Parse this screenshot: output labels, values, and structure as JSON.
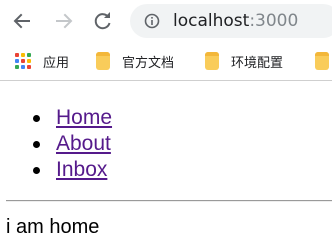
{
  "browser": {
    "url_host": "localhost",
    "url_port": ":3000",
    "icons": {
      "back": "arrow-left-icon",
      "forward": "arrow-right-icon",
      "reload": "reload-icon",
      "site_info": "info-icon"
    }
  },
  "bookmarks": [
    {
      "label": "应用",
      "icon": "apps-grid-icon"
    },
    {
      "label": "官方文档",
      "icon": "folder-icon"
    },
    {
      "label": "环境配置",
      "icon": "folder-icon"
    }
  ],
  "nav": {
    "links": [
      "Home",
      "About",
      "Inbox"
    ],
    "link_color": "#551a8b"
  },
  "main": {
    "text": "i am home"
  }
}
